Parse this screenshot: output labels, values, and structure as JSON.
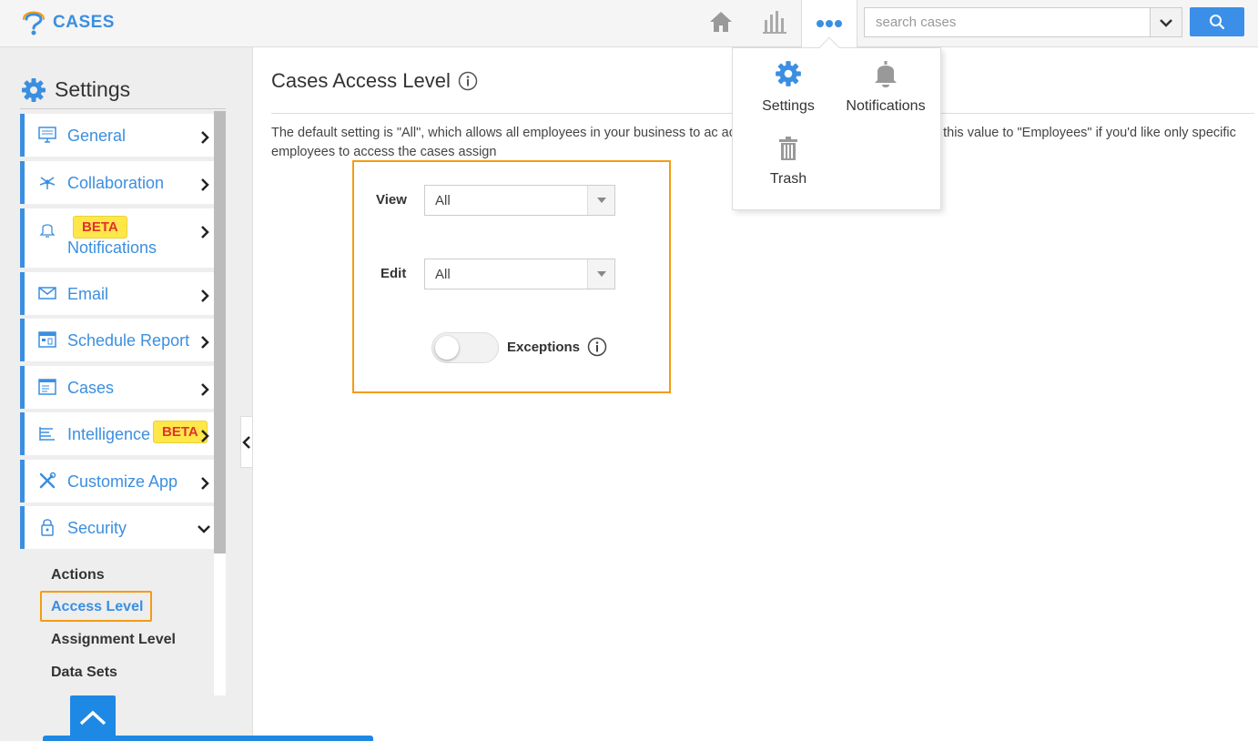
{
  "app": {
    "title": "CASES"
  },
  "search": {
    "placeholder": "search cases"
  },
  "more_menu": {
    "items": [
      {
        "label": "Settings",
        "icon": "gear-icon"
      },
      {
        "label": "Notifications",
        "icon": "bell-icon"
      },
      {
        "label": "Trash",
        "icon": "trash-icon"
      }
    ]
  },
  "sidebar": {
    "title": "Settings",
    "items": [
      {
        "label": "General",
        "icon": "monitor-icon"
      },
      {
        "label": "Collaboration",
        "icon": "network-icon"
      },
      {
        "label": "Notifications",
        "icon": "bell-icon",
        "badge": "BETA"
      },
      {
        "label": "Email",
        "icon": "envelope-icon"
      },
      {
        "label": "Schedule Report",
        "icon": "calendar-icon"
      },
      {
        "label": "Cases",
        "icon": "cases-icon"
      },
      {
        "label": "Intelligence",
        "icon": "bars-icon",
        "badge": "BETA"
      },
      {
        "label": "Customize App",
        "icon": "tools-icon"
      },
      {
        "label": "Security",
        "icon": "lock-icon"
      }
    ],
    "security_sub": [
      "Actions",
      "Access Level",
      "Assignment Level",
      "Data Sets"
    ],
    "active_sub": "Access Level"
  },
  "main": {
    "title": "Cases Access Level",
    "description": "The default setting is \"All\", which allows all employees in your business to ac                                                          access to the cases App. You can set this value to \"Employees\" if you'd like only specific employees to access the cases assign",
    "view_label": "View",
    "view_value": "All",
    "edit_label": "Edit",
    "edit_value": "All",
    "exceptions_label": "Exceptions",
    "exceptions_enabled": false
  },
  "colors": {
    "accent": "#3b8fe0",
    "highlight": "#f39c12",
    "beta_bg": "#ffe74a",
    "beta_text": "#e1332b"
  }
}
